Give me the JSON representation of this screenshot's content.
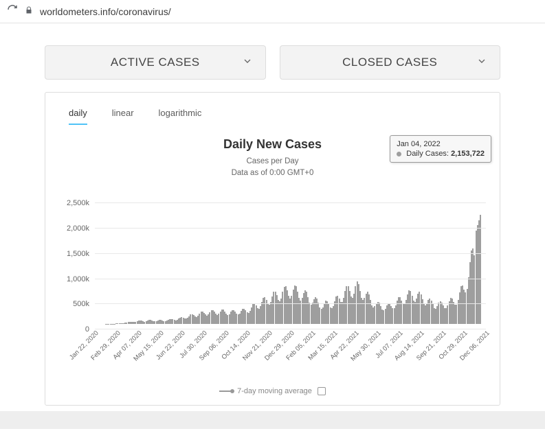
{
  "browser": {
    "url": "worldometers.info/coronavirus/"
  },
  "toggles": {
    "active": "ACTIVE CASES",
    "closed": "CLOSED CASES"
  },
  "tabs": {
    "daily": "daily",
    "linear": "linear",
    "log": "logarithmic"
  },
  "chart": {
    "title": "Daily New Cases",
    "sub1": "Cases per Day",
    "sub2": "Data as of 0:00 GMT+0"
  },
  "tooltip": {
    "date": "Jan 04, 2022",
    "series_label": "Daily Cases:",
    "value": "2,153,722"
  },
  "legend": {
    "ma": "7-day moving average"
  },
  "chart_data": {
    "type": "bar",
    "title": "Daily New Cases",
    "xlabel": "",
    "ylabel": "",
    "ylim": [
      0,
      2600000
    ],
    "y_ticks": [
      0,
      500000,
      1000000,
      1500000,
      2000000,
      2500000
    ],
    "y_tick_labels": [
      "0",
      "500k",
      "1,000k",
      "1,500k",
      "2,000k",
      "2,500k"
    ],
    "x_tick_labels": [
      "Jan 22, 2020",
      "Feb 29, 2020",
      "Apr 07, 2020",
      "May 15, 2020",
      "Jun 22, 2020",
      "Jul 30, 2020",
      "Sep 06, 2020",
      "Oct 14, 2020",
      "Nov 21, 2020",
      "Dec 29, 2020",
      "Feb 05, 2021",
      "Mar 15, 2021",
      "Apr 22, 2021",
      "May 30, 2021",
      "Jul 07, 2021",
      "Aug 14, 2021",
      "Sep 21, 2021",
      "Oct 29, 2021",
      "Dec 06, 2021"
    ],
    "tooltip_point": {
      "date": "Jan 04, 2022",
      "value": 2153722
    },
    "envelope": [
      {
        "t": 0.0,
        "v": 0
      },
      {
        "t": 0.04,
        "v": 2000
      },
      {
        "t": 0.08,
        "v": 40000
      },
      {
        "t": 0.12,
        "v": 80000
      },
      {
        "t": 0.15,
        "v": 85000
      },
      {
        "t": 0.18,
        "v": 90000
      },
      {
        "t": 0.22,
        "v": 130000
      },
      {
        "t": 0.25,
        "v": 200000
      },
      {
        "t": 0.28,
        "v": 260000
      },
      {
        "t": 0.3,
        "v": 280000
      },
      {
        "t": 0.33,
        "v": 290000
      },
      {
        "t": 0.36,
        "v": 280000
      },
      {
        "t": 0.39,
        "v": 320000
      },
      {
        "t": 0.42,
        "v": 450000
      },
      {
        "t": 0.45,
        "v": 600000
      },
      {
        "t": 0.48,
        "v": 700000
      },
      {
        "t": 0.5,
        "v": 800000
      },
      {
        "t": 0.53,
        "v": 750000
      },
      {
        "t": 0.56,
        "v": 600000
      },
      {
        "t": 0.59,
        "v": 450000
      },
      {
        "t": 0.62,
        "v": 500000
      },
      {
        "t": 0.65,
        "v": 750000
      },
      {
        "t": 0.68,
        "v": 850000
      },
      {
        "t": 0.7,
        "v": 700000
      },
      {
        "t": 0.73,
        "v": 450000
      },
      {
        "t": 0.76,
        "v": 400000
      },
      {
        "t": 0.79,
        "v": 550000
      },
      {
        "t": 0.82,
        "v": 700000
      },
      {
        "t": 0.84,
        "v": 650000
      },
      {
        "t": 0.87,
        "v": 500000
      },
      {
        "t": 0.9,
        "v": 450000
      },
      {
        "t": 0.92,
        "v": 500000
      },
      {
        "t": 0.94,
        "v": 600000
      },
      {
        "t": 0.96,
        "v": 900000
      },
      {
        "t": 0.975,
        "v": 1400000
      },
      {
        "t": 0.99,
        "v": 1900000
      },
      {
        "t": 1.0,
        "v": 2153722
      }
    ]
  }
}
